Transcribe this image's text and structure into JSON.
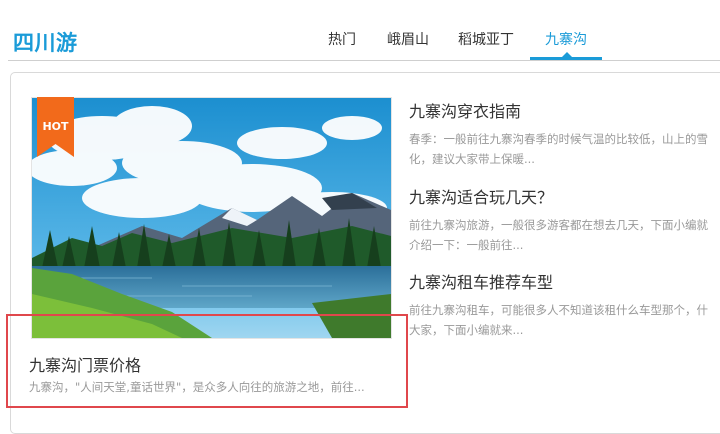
{
  "header": {
    "site_title": "四川游",
    "tabs": [
      {
        "label": "热门",
        "active": false
      },
      {
        "label": "峨眉山",
        "active": false
      },
      {
        "label": "稻城亚丁",
        "active": false
      },
      {
        "label": "九寨沟",
        "active": true
      }
    ]
  },
  "feature": {
    "badge": "HOT",
    "title": "九寨沟门票价格",
    "description": "九寨沟，\"人间天堂,童话世界\"，是众多人向往的旅游之地，前往..."
  },
  "articles": [
    {
      "title": "九寨沟穿衣指南",
      "desc_line1": "春季：一般前往九寨沟春季的时候气温的比较低，山上的雪",
      "desc_line2": "化，建议大家带上保暖..."
    },
    {
      "title": "九寨沟适合玩几天？",
      "desc_line1": "前往九寨沟旅游，一般很多游客都在想去几天，下面小编就",
      "desc_line2": "介绍一下：一般前往..."
    },
    {
      "title": "九寨沟租车推荐车型",
      "desc_line1": "前往九寨沟租车，可能很多人不知道该租什么车型那个，什",
      "desc_line2": "大家，下面小编就来..."
    }
  ],
  "colors": {
    "accent": "#1a9bd8",
    "hot_ribbon": "#f26a1b",
    "highlight_border": "#e0474c"
  }
}
